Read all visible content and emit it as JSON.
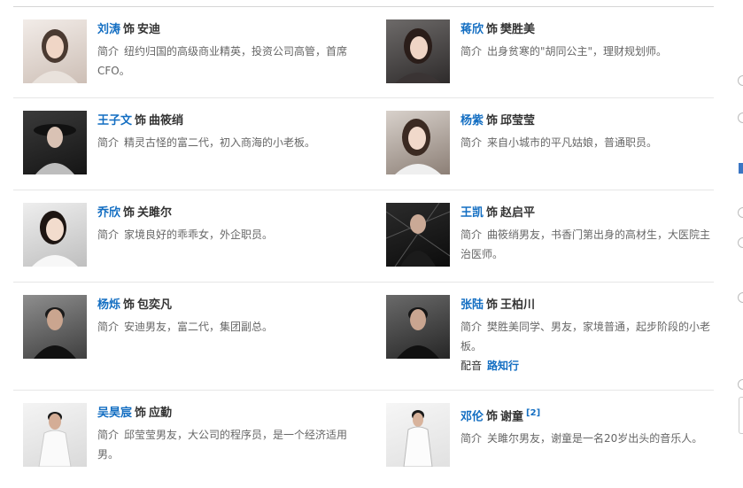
{
  "labels": {
    "intro": "简介",
    "as": "饰",
    "voice": "配音"
  },
  "cast": [
    {
      "actor": "刘涛",
      "role": "安迪",
      "intro": "纽约归国的高级商业精英，投资公司高管，首席CFO。",
      "side": "left"
    },
    {
      "actor": "蒋欣",
      "role": "樊胜美",
      "intro": "出身贫寒的\"胡同公主\"，理财规划师。",
      "side": "right"
    },
    {
      "actor": "王子文",
      "role": "曲筱绡",
      "intro": "精灵古怪的富二代，初入商海的小老板。",
      "side": "left"
    },
    {
      "actor": "杨紫",
      "role": "邱莹莹",
      "intro": "来自小城市的平凡姑娘，普通职员。",
      "side": "right"
    },
    {
      "actor": "乔欣",
      "role": "关雎尔",
      "intro": "家境良好的乖乖女，外企职员。",
      "side": "left"
    },
    {
      "actor": "王凯",
      "role": "赵启平",
      "intro": "曲筱绡男友，书香门第出身的高材生，大医院主治医师。",
      "side": "right"
    },
    {
      "actor": "杨烁",
      "role": "包奕凡",
      "intro": "安迪男友，富二代，集团副总。",
      "side": "left"
    },
    {
      "actor": "张陆",
      "role": "王柏川",
      "intro": "樊胜美同学、男友，家境普通，起步阶段的小老板。",
      "voice": "路知行",
      "side": "right"
    },
    {
      "actor": "吴昊宸",
      "role": "应勤",
      "intro": "邱莹莹男友，大公司的程序员，是一个经济适用男。",
      "side": "left"
    },
    {
      "actor": "邓伦",
      "role": "谢童",
      "cite": "[2]",
      "intro": "关雎尔男友，谢童是一名20岁出头的音乐人。",
      "side": "right"
    }
  ]
}
